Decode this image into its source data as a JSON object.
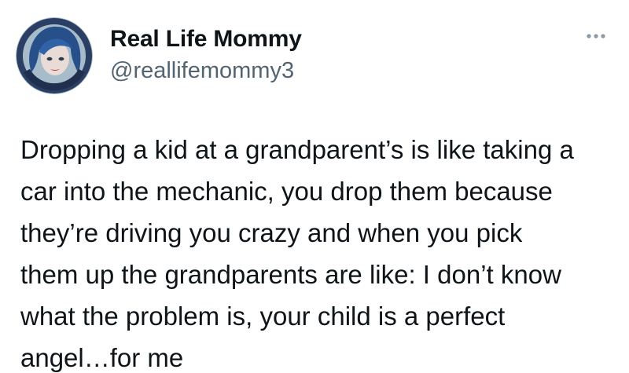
{
  "tweet": {
    "author": {
      "display_name": "Real Life Mommy",
      "handle": "@reallifemommy3",
      "avatar_icon": "cartoon-woman-avatar-icon"
    },
    "more_icon": "more-options-icon",
    "text": "Dropping a kid at a grandparent’s is like taking a\ncar into the mechanic, you drop them because\nthey’re driving you crazy and when you pick\nthem up the grandparents are like: I don’t know\nwhat the problem is, your child is a perfect\nangel…for me"
  },
  "colors": {
    "text_primary": "#0f1419",
    "text_secondary": "#536471",
    "avatar_bg": "#9fb7c8",
    "avatar_hair": "#274f8a"
  }
}
